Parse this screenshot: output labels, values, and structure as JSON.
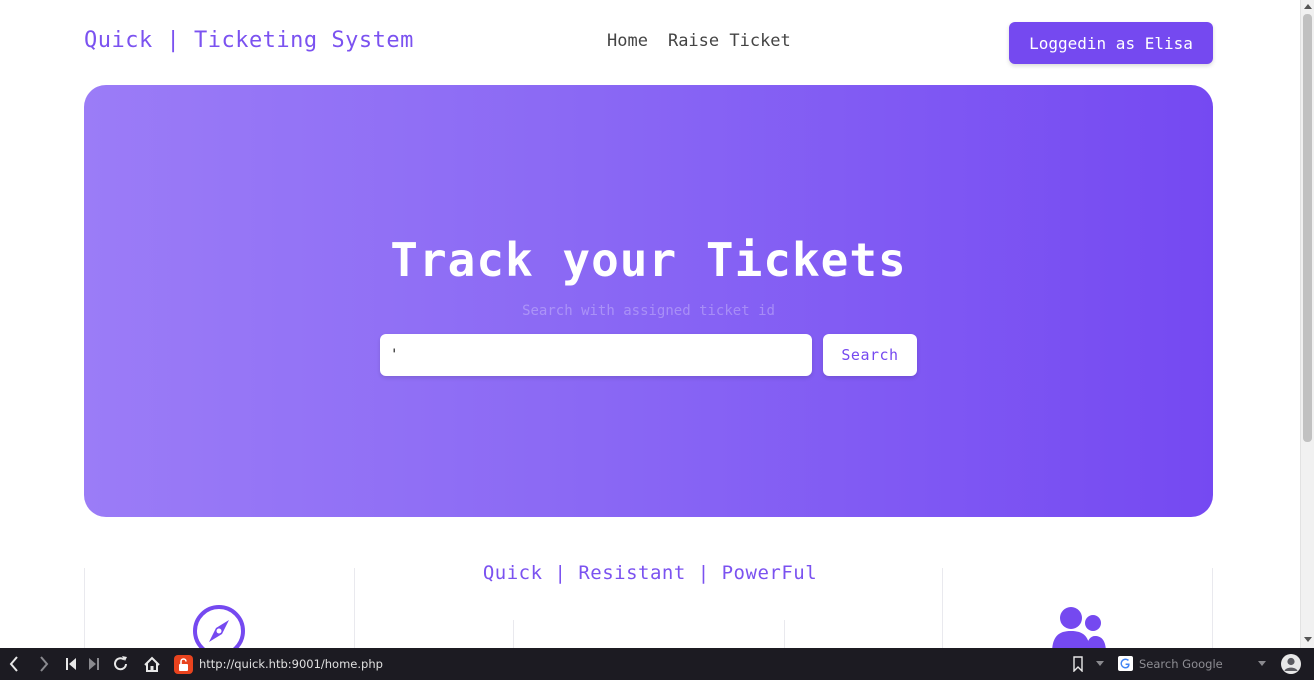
{
  "header": {
    "brand": "Quick | Ticketing System",
    "nav": [
      {
        "label": "Home"
      },
      {
        "label": "Raise Ticket"
      }
    ],
    "login_label": "Loggedin as Elisa"
  },
  "hero": {
    "title": "Track your Tickets",
    "subtitle": "Search with assigned ticket id",
    "search_value": "'",
    "search_button": "Search"
  },
  "features": {
    "tagline": "Quick | Resistant | PowerFul",
    "icons": [
      "compass-icon",
      "users-icon"
    ]
  },
  "browser": {
    "url": "http://quick.htb:9001/home.php",
    "search_placeholder": "Search Google"
  },
  "colors": {
    "accent": "#7549f0",
    "hero_gradient_start": "#9b7cf7",
    "hero_gradient_end": "#7549f2",
    "toolbar_bg": "#1c1b22"
  }
}
